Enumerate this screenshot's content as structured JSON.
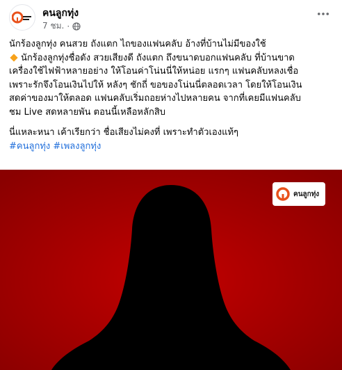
{
  "header": {
    "page_name": "คนลูกทุ่ง",
    "timestamp": "7 ชม.",
    "separator": "·",
    "privacy_icon": "globe-icon",
    "more_icon": "more-dots-icon"
  },
  "post": {
    "line1": "นักร้องลูกทุ่ง คนสวย ถังแตก ไถของแฟนคลับ อ้างที่บ้านไม่มีของใช้",
    "line2_icon": "orange-diamond-icon",
    "line2": "นักร้องลูกทุ่งชื่อดัง สวยเสียงดี ถังแตก ถึงขนาดบอกแฟนคลับ ที่บ้านขาด",
    "line3": "เครื่องใช้ไฟฟ้าหลายอย่าง ให้โอนค่าโน่นนี่ให้หน่อย แรกๆ แฟนคลับหลงเชื่อ",
    "line4": "เพราะรักจึงโอนเงินไปให้ หลังๆ ชักถี่ ขอของโน่นนี่ตลอดเวลา โดยให้โอนเงิน",
    "line5": "สดค่าของมาให้ตลอด แฟนคลับเริ่มถอยห่างไปหลายคน จากที่เคยมีแฟนคลับ",
    "line6": "ชม Live สดหลายพัน ตอนนี้เหลือหลักสิบ",
    "line7": "นี่แหละหนา เค้าเรียกว่า ชื่อเสียงไม่คงที่ เพราะทำตัวเองแท้ๆ",
    "hashtag1": "#คนลูกทุ่ง",
    "hashtag2": "#เพลงลูกทุ่ง"
  },
  "media": {
    "logo_text": "คนลูกทุ่ง",
    "background_color": "#aa0000",
    "silhouette_color": "#000000"
  }
}
